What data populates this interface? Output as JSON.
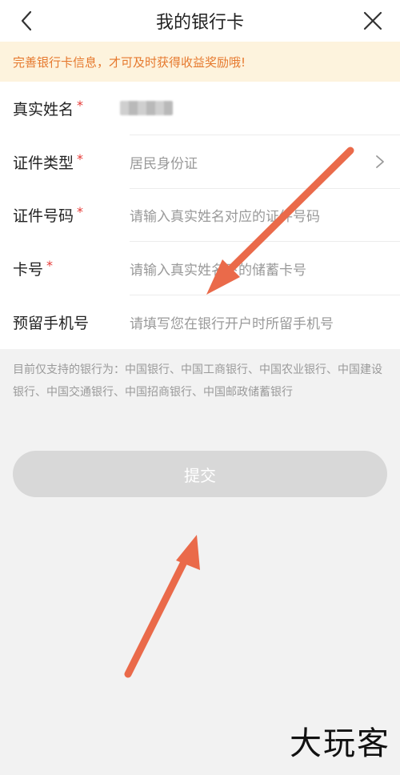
{
  "header": {
    "title": "我的银行卡",
    "back_icon": "chevron-left-icon",
    "close_icon": "close-icon"
  },
  "notice": "完善银行卡信息，才可及时获得收益奖励哦!",
  "form": {
    "name": {
      "label": "真实姓名",
      "required_mark": "*"
    },
    "id_type": {
      "label": "证件类型",
      "required_mark": "*",
      "value": "居民身份证",
      "icon": "chevron-right-icon"
    },
    "id_number": {
      "label": "证件号码",
      "required_mark": "*",
      "placeholder": "请输入真实姓名对应的证件号码"
    },
    "card_number": {
      "label": "卡号",
      "required_mark": "*",
      "placeholder": "请输入真实姓名下的储蓄卡号"
    },
    "phone": {
      "label": "预留手机号",
      "placeholder": "请填写您在银行开户时所留手机号"
    }
  },
  "supported_banks": "目前仅支持的银行为：中国银行、中国工商银行、中国农业银行、中国建设银行、中国交通银行、中国招商银行、中国邮政储蓄银行",
  "submit_label": "提交",
  "watermark": "大玩客",
  "colors": {
    "notice_bg": "#fdf3dd",
    "notice_text": "#e6792e",
    "required": "#e53935",
    "arrow": "#ea6a4a",
    "submit_bg": "#d8d8d8"
  }
}
